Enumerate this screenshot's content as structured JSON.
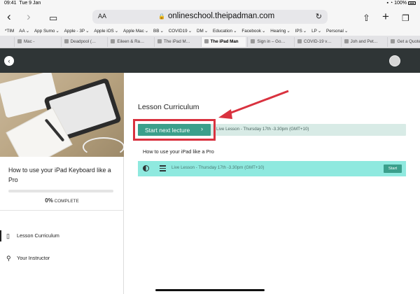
{
  "status": {
    "time": "09:41",
    "date": "Tue 9 Jan",
    "battery": "100%"
  },
  "browser": {
    "aa_label": "AA",
    "url_host": "onlineschool.theipadman.com",
    "bookmarks": [
      "*TIM",
      "AA",
      "App Sumo",
      "Apple - 3P",
      "Apple iOS",
      "Apple Mac",
      "BB",
      "COVID19",
      "DM",
      "Education",
      "Facebook",
      "Hearing",
      "IPS",
      "LP",
      "Personal"
    ],
    "tabs": [
      {
        "label": "Mac - ",
        "active": false
      },
      {
        "label": "Deadpool (…",
        "active": false
      },
      {
        "label": "Eileen & Ra…",
        "active": false
      },
      {
        "label": "The iPad M…",
        "active": false
      },
      {
        "label": "The iPad Man",
        "active": true
      },
      {
        "label": "Sign in – Go…",
        "active": false
      },
      {
        "label": "COVID-19 v…",
        "active": false
      },
      {
        "label": "Joh and Pet…",
        "active": false
      },
      {
        "label": "Get a Quote…",
        "active": false
      }
    ]
  },
  "sidebar": {
    "course_title": "How to use your iPad Keyboard like a Pro",
    "progress_percent": 0,
    "progress_value": "0%",
    "progress_label": "COMPLETE",
    "nav": [
      {
        "label": "Lesson Curriculum",
        "icon": "book-icon"
      },
      {
        "label": "Your Instructor",
        "icon": "person-icon"
      }
    ]
  },
  "main": {
    "heading": "Lesson Curriculum",
    "start_button": "Start next lecture",
    "live_bar_text": "Live Lesson - Thursday 17th -3.30pm (GMT+10)",
    "section_title": "How to use your iPad like a Pro",
    "lecture": {
      "title": "Live Lesson - Thursday 17th -3.30pm (GMT+10)",
      "button": "Start"
    }
  },
  "colors": {
    "accent": "#3b9f8b",
    "header": "#2f3536",
    "highlight": "#d9323f",
    "lecture_row": "#8fe9df"
  }
}
